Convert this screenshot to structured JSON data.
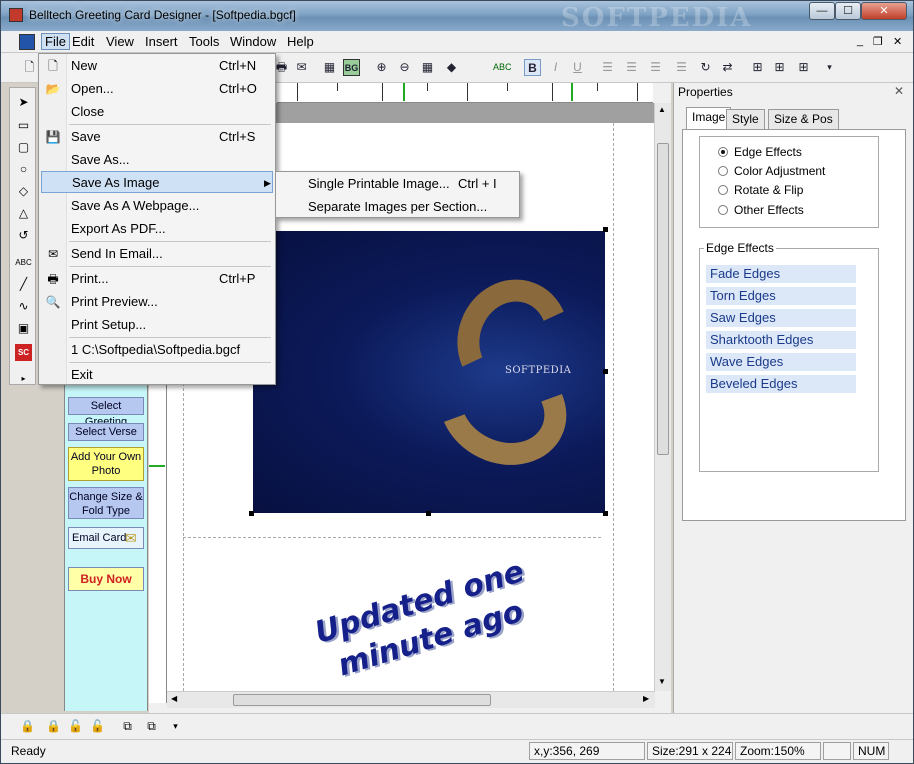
{
  "window": {
    "title": "Belltech Greeting Card Designer  - [Softpedia.bgcf]",
    "watermark": "SOFTPEDIA",
    "controls": {
      "minimize": "—",
      "maximize": "☐",
      "close": "✕"
    }
  },
  "menubar": {
    "items": [
      "File",
      "Edit",
      "View",
      "Insert",
      "Tools",
      "Window",
      "Help"
    ],
    "mdi_controls": [
      "_",
      "❐",
      "✕"
    ]
  },
  "file_menu": {
    "items": [
      {
        "label": "New",
        "shortcut": "Ctrl+N",
        "icon": "new-doc-icon",
        "glyph": "🗋"
      },
      {
        "label": "Open...",
        "shortcut": "Ctrl+O",
        "icon": "open-folder-icon",
        "glyph": "📂"
      },
      {
        "label": "Close",
        "shortcut": "",
        "icon": "",
        "glyph": ""
      },
      {
        "label": "Save",
        "shortcut": "Ctrl+S",
        "icon": "save-disk-icon",
        "glyph": "💾"
      },
      {
        "label": "Save As...",
        "shortcut": "",
        "icon": "",
        "glyph": ""
      },
      {
        "label": "Save As Image",
        "shortcut": "",
        "icon": "",
        "glyph": "",
        "submenu": true
      },
      {
        "label": "Save As A Webpage...",
        "shortcut": "",
        "icon": "",
        "glyph": ""
      },
      {
        "label": "Export As PDF...",
        "shortcut": "",
        "icon": "",
        "glyph": ""
      },
      {
        "label": "Send In Email...",
        "shortcut": "",
        "icon": "email-icon",
        "glyph": "✉"
      },
      {
        "label": "Print...",
        "shortcut": "Ctrl+P",
        "icon": "printer-icon",
        "glyph": "🖶"
      },
      {
        "label": "Print Preview...",
        "shortcut": "",
        "icon": "print-preview-icon",
        "glyph": "🔍"
      },
      {
        "label": "Print Setup...",
        "shortcut": "",
        "icon": "",
        "glyph": ""
      },
      {
        "label": "1 C:\\Softpedia\\Softpedia.bgcf",
        "shortcut": "",
        "icon": "",
        "glyph": ""
      },
      {
        "label": "Exit",
        "shortcut": "",
        "icon": "",
        "glyph": ""
      }
    ]
  },
  "save_as_image_submenu": {
    "items": [
      {
        "label": "Single Printable Image...",
        "shortcut": "Ctrl + I"
      },
      {
        "label": "Separate Images per Section...",
        "shortcut": ""
      }
    ]
  },
  "wizard": {
    "buttons": [
      "Select Greeting",
      "Select Verse",
      "Add Your Own Photo",
      "Change Size & Fold Type",
      "Email Card",
      "Buy Now"
    ]
  },
  "canvas": {
    "photo_logo": "SOFTPEDIA",
    "wordart_line1": "Updated one",
    "wordart_line2": "minute ago"
  },
  "properties": {
    "title": "Properties",
    "close": "✕",
    "tabs": [
      "Image",
      "Style",
      "Size & Pos"
    ],
    "active_tab": "Image",
    "options": [
      {
        "label": "Edge Effects",
        "selected": true
      },
      {
        "label": "Color Adjustment",
        "selected": false
      },
      {
        "label": "Rotate & Flip",
        "selected": false
      },
      {
        "label": "Other Effects",
        "selected": false
      }
    ],
    "group_title": "Edge Effects",
    "effects": [
      "Fade Edges",
      "Torn Edges",
      "Saw Edges",
      "Sharktooth Edges",
      "Wave Edges",
      "Beveled Edges"
    ]
  },
  "statusbar": {
    "status": "Ready",
    "coords": "x,y:356, 269",
    "size": "Size:291 x 224",
    "zoom": "Zoom:150%",
    "num": "NUM"
  }
}
